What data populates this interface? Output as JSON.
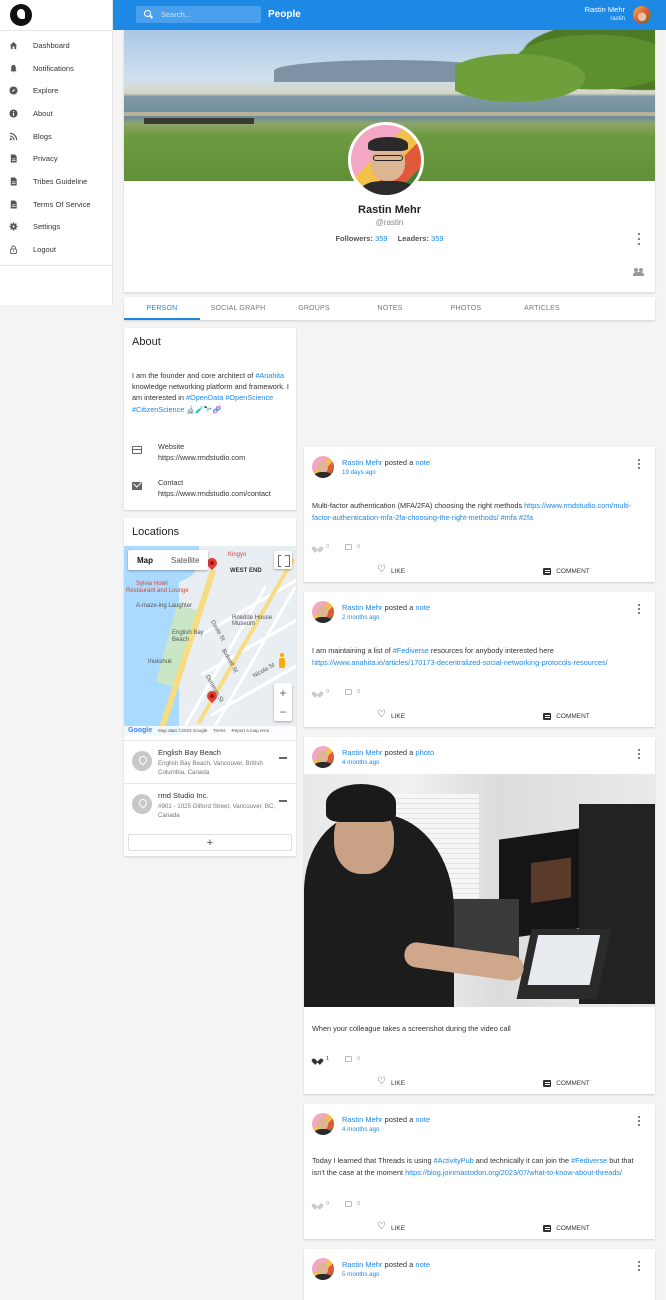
{
  "sidebar": {
    "items": [
      {
        "label": "Dashboard",
        "icon": "home-icon"
      },
      {
        "label": "Notifications",
        "icon": "bell-icon"
      },
      {
        "label": "Explore",
        "icon": "compass-icon"
      },
      {
        "label": "About",
        "icon": "info-icon"
      },
      {
        "label": "Blogs",
        "icon": "rss-icon"
      },
      {
        "label": "Privacy",
        "icon": "document-icon"
      },
      {
        "label": "Tribes Guideline",
        "icon": "document-icon"
      },
      {
        "label": "Terms Of Service",
        "icon": "document-icon"
      },
      {
        "label": "Settings",
        "icon": "gear-icon"
      },
      {
        "label": "Logout",
        "icon": "lock-icon"
      }
    ]
  },
  "topbar": {
    "search_placeholder": "Search...",
    "title": "People",
    "user_name": "Rastin Mehr",
    "user_handle": "rastin",
    "color": "#1e88e5"
  },
  "profile": {
    "name": "Rastin Mehr",
    "handle": "@rastin",
    "followers_label": "Followers:",
    "followers_count": "359",
    "leaders_label": "Leaders:",
    "leaders_count": "359"
  },
  "tabs": [
    "PERSON",
    "SOCIAL GRAPH",
    "GROUPS",
    "NOTES",
    "PHOTOS",
    "ARTICLES"
  ],
  "about": {
    "title": "About",
    "text_1": "I am the founder and core architect of ",
    "tag_anahita": "#Anahita",
    "text_2": " knowledge networking platform and framework. I am interested in ",
    "tag_opendata": "#OpenData",
    "tag_openscience": "#OpenScience",
    "tag_citizenscience": "#CitizenScience",
    "emojis": "🔬🧪🔭🧬",
    "website_label": "Website",
    "website_url": "https://www.rmdstudio.com",
    "contact_label": "Contact",
    "contact_url": "https://www.rmdstudio.com/contact"
  },
  "locations": {
    "title": "Locations",
    "map_tab": "Map",
    "satellite_tab": "Satellite",
    "map_labels": {
      "west_end": "WEST END",
      "kingyo": "Kingyo",
      "sylvia": "Sylvia Hotel",
      "restaurant": "Restaurant and Lounge",
      "amazing": "A-maze-ing Laughter",
      "roedde": "Roedde House Museum",
      "english_bay": "English Bay Beach",
      "inukshuk": "Inukshuk",
      "street_1": "Davie St",
      "street_2": "Bidwell St",
      "street_3": "Denman St",
      "street_4": "Nicola St"
    },
    "map_footer": {
      "brand": "Google",
      "data": "Map data ©2023 Google",
      "terms": "Terms",
      "report": "Report a map error"
    },
    "items": [
      {
        "name": "English Bay Beach",
        "address": "English Bay Beach, Vancouver, British Columbia, Canada"
      },
      {
        "name": "rmd Studio Inc.",
        "address": "#901 - 1025 Gilford Street, Vancouver, BC, Canada"
      }
    ],
    "add_label": "+"
  },
  "posts": [
    {
      "author": "Rastin Mehr",
      "verb": "posted a",
      "type": "note",
      "time": "19 days ago",
      "text": "Multi-factor authentication (MFA/2FA) choosing the right methods ",
      "link": "https://www.rmdstudio.com/multi-factor-authentication-mfa-2fa-choosing-the-right-methods/",
      "tags": " #mfa #2fa",
      "likes": "0",
      "comments": "0"
    },
    {
      "author": "Rastin Mehr",
      "verb": "posted a",
      "type": "note",
      "time": "2 months ago",
      "text_1": "I am maintaining a list of ",
      "tag": "#Fediverse",
      "text_2": " resources for anybody interested here ",
      "link": "https://www.anahita.io/articles/170173-decentralized-social-networking-protocols-resources/",
      "likes": "0",
      "comments": "0"
    },
    {
      "author": "Rastin Mehr",
      "verb": "posted a",
      "type": "photo",
      "time": "4 months ago",
      "text": "When your colleague takes a screenshot during the video call",
      "likes": "1",
      "comments": "0"
    },
    {
      "author": "Rastin Mehr",
      "verb": "posted a",
      "type": "note",
      "time": "4 months ago",
      "text_1": "Today I learned that Threads is using ",
      "tag_1": "#ActivityPub",
      "text_2": " and technically it can join the ",
      "tag_2": "#Fediverse",
      "text_3": " but that isn't the case at the moment ",
      "link": "https://blog.joinmastodon.org/2023/07/what-to-know-about-threads/",
      "likes": "0",
      "comments": "0"
    },
    {
      "author": "Rastin Mehr",
      "verb": "posted a",
      "type": "note",
      "time": "5 months ago"
    }
  ],
  "actions": {
    "like": "LIKE",
    "comment": "COMMENT"
  }
}
